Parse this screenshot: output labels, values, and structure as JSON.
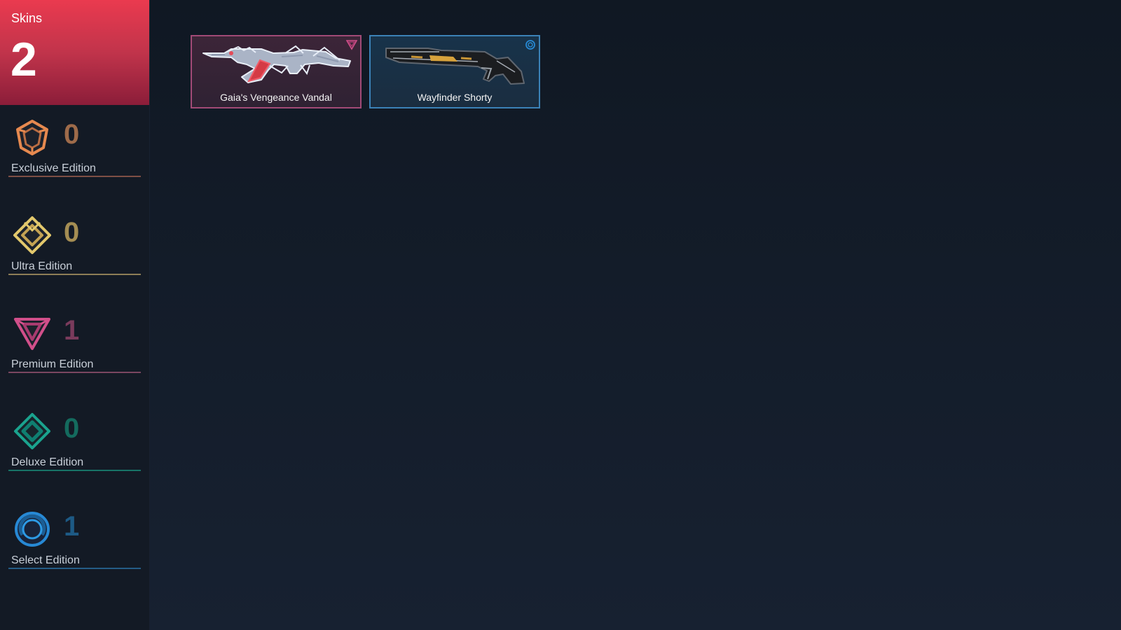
{
  "summary": {
    "label": "Skins",
    "total": "2",
    "accent_color": "#ea3a4f"
  },
  "tiers": [
    {
      "name": "Exclusive Edition",
      "count": "0",
      "icon": "exclusive-edition-icon",
      "color": "#e6894f",
      "count_color": "#9e6b4a"
    },
    {
      "name": "Ultra Edition",
      "count": "0",
      "icon": "ultra-edition-icon",
      "color": "#e2c86c",
      "count_color": "#a48d53"
    },
    {
      "name": "Premium Edition",
      "count": "1",
      "icon": "premium-edition-icon",
      "color": "#d14f8a",
      "count_color": "#7a3b5c"
    },
    {
      "name": "Deluxe Edition",
      "count": "0",
      "icon": "deluxe-edition-icon",
      "color": "#1aa38e",
      "count_color": "#146b5e"
    },
    {
      "name": "Select Edition",
      "count": "1",
      "icon": "select-edition-icon",
      "color": "#2789d5",
      "count_color": "#1d5a85"
    }
  ],
  "skins": [
    {
      "name": "Gaia's Vengeance Vandal",
      "tier": "Premium Edition",
      "icon": "vandal-icon",
      "badge_icon": "premium-edition-icon",
      "border_color": "#a14a76"
    },
    {
      "name": "Wayfinder Shorty",
      "tier": "Select Edition",
      "icon": "shorty-icon",
      "badge_icon": "select-edition-icon",
      "border_color": "#3b82b7"
    }
  ]
}
